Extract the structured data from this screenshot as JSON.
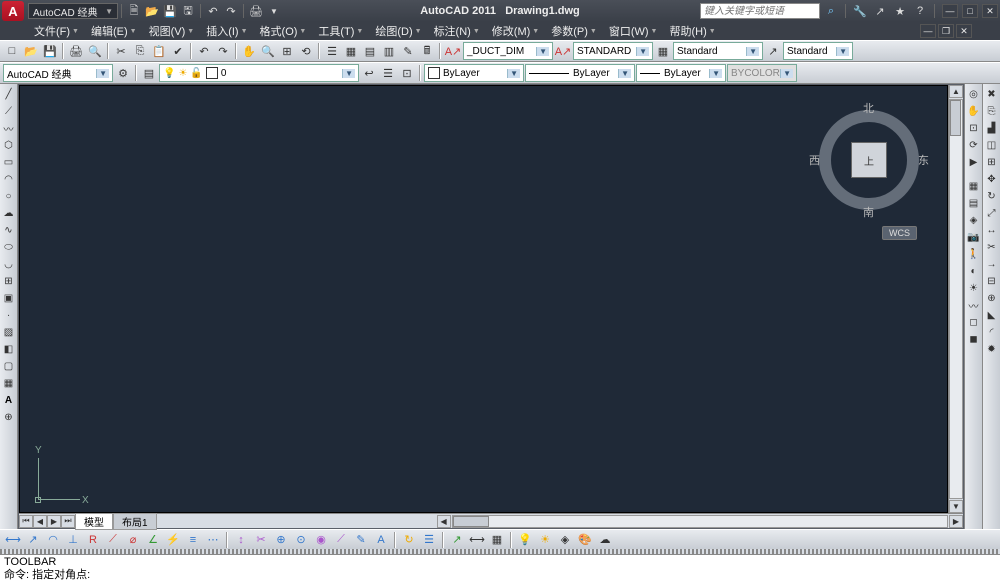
{
  "title": {
    "app": "AutoCAD 2011",
    "doc": "Drawing1.dwg"
  },
  "workspace": "AutoCAD 经典",
  "search_placeholder": "键入关键字或短语",
  "menus": [
    "文件(F)",
    "编辑(E)",
    "视图(V)",
    "插入(I)",
    "格式(O)",
    "工具(T)",
    "绘图(D)",
    "标注(N)",
    "修改(M)",
    "参数(P)",
    "窗口(W)",
    "帮助(H)"
  ],
  "row1": {
    "workspace_combo": "AutoCAD 经典",
    "layer_combo": "0",
    "dimstyle": "_DUCT_DIM",
    "textstyle1": "STANDARD",
    "textstyle2": "Standard",
    "textstyle3": "Standard"
  },
  "row2": {
    "color": "ByLayer",
    "linetype": "ByLayer",
    "lineweight": "ByLayer",
    "plotstyle": "BYCOLOR"
  },
  "viewcube": {
    "top": "北",
    "bottom": "南",
    "left": "西",
    "right": "东",
    "face": "上",
    "wcs": "WCS"
  },
  "ucs": {
    "x": "X",
    "y": "Y"
  },
  "tabs": {
    "model": "模型",
    "layout": "布局1"
  },
  "cmd": {
    "l1": "TOOLBAR",
    "l2": "命令: 指定对角点:"
  }
}
